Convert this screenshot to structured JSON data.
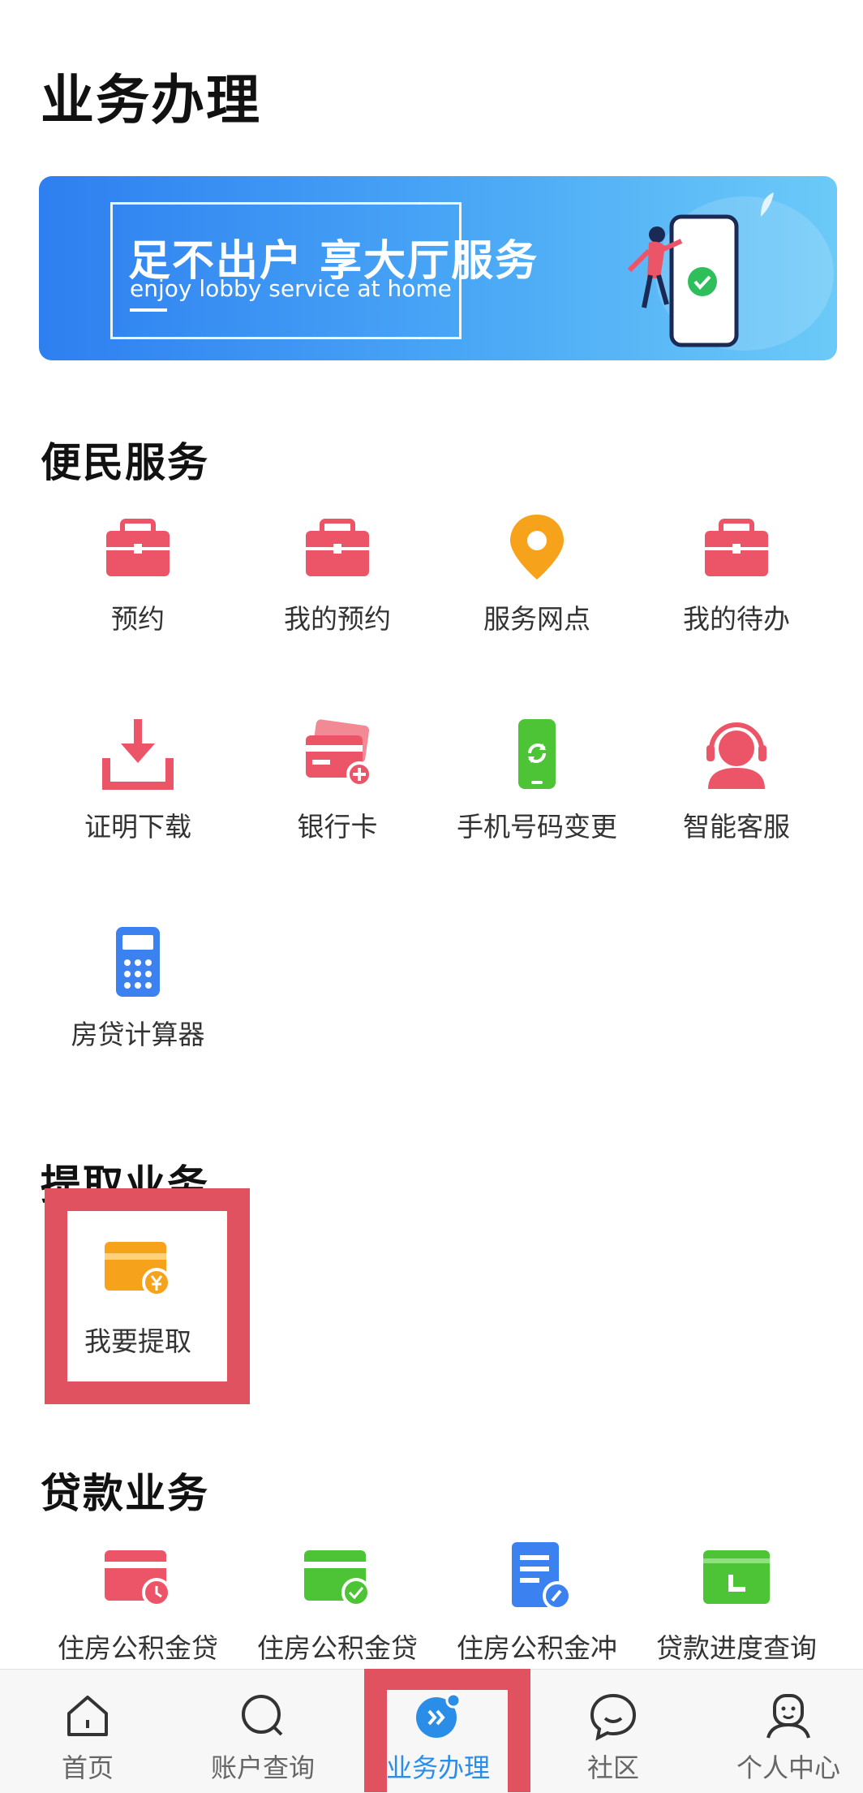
{
  "header": {
    "title": "业务办理"
  },
  "banner": {
    "headline": "足不出户 享大厅服务",
    "subline": "enjoy lobby service at home"
  },
  "sections": {
    "convenience": {
      "title": "便民服务",
      "items": [
        {
          "label": "预约",
          "icon": "briefcase-icon"
        },
        {
          "label": "我的预约",
          "icon": "briefcase-icon"
        },
        {
          "label": "服务网点",
          "icon": "location-pin-icon"
        },
        {
          "label": "我的待办",
          "icon": "briefcase-icon"
        },
        {
          "label": "证明下载",
          "icon": "download-icon"
        },
        {
          "label": "银行卡",
          "icon": "bank-card-icon"
        },
        {
          "label": "手机号码变更",
          "icon": "phone-refresh-icon"
        },
        {
          "label": "智能客服",
          "icon": "customer-service-icon"
        },
        {
          "label": "房贷计算器",
          "icon": "calculator-icon"
        }
      ]
    },
    "withdrawal": {
      "title": "提取业务",
      "items": [
        {
          "label": "我要提取",
          "icon": "wallet-yuan-icon"
        }
      ]
    },
    "loan": {
      "title": "贷款业务",
      "items": [
        {
          "label": "住房公积金贷",
          "icon": "card-clock-icon"
        },
        {
          "label": "住房公积金贷",
          "icon": "card-check-icon"
        },
        {
          "label": "住房公积金冲",
          "icon": "document-edit-icon"
        },
        {
          "label": "贷款进度查询",
          "icon": "folder-progress-icon"
        }
      ]
    }
  },
  "bottom_nav": {
    "items": [
      {
        "label": "首页",
        "icon": "home-icon"
      },
      {
        "label": "账户查询",
        "icon": "search-icon"
      },
      {
        "label": "业务办理",
        "icon": "business-icon",
        "active": true
      },
      {
        "label": "社区",
        "icon": "chat-bubble-icon"
      },
      {
        "label": "个人中心",
        "icon": "user-icon"
      }
    ]
  },
  "colors": {
    "accent": "#2a8ee8",
    "icon_red": "#ec5468",
    "icon_orange": "#f7a21b",
    "icon_green": "#4cc436",
    "icon_blue": "#3b82f0",
    "highlight": "#e0525f"
  }
}
